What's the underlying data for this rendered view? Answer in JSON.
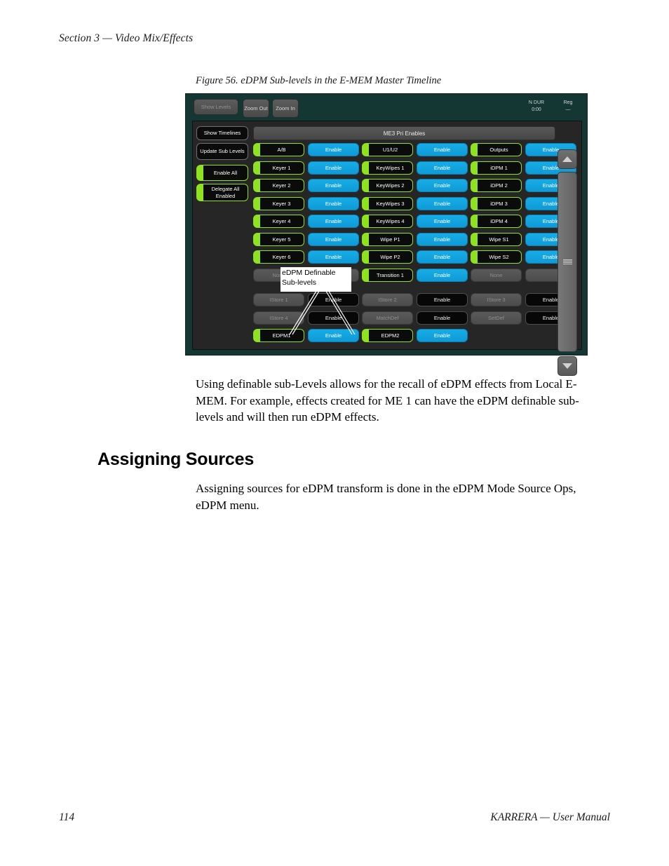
{
  "document": {
    "header": "Section 3 — Video Mix/Effects",
    "page_number": "114",
    "footer_right": "KARRERA  —  User Manual",
    "figure_caption": "Figure 56.  eDPM Sub-levels in the E-MEM Master Timeline",
    "paragraph_1": "Using definable sub-Levels allows for the recall of eDPM effects from Local E-MEM. For example, effects created for ME 1 can have the eDPM definable sub-levels and will then run eDPM effects.",
    "section_heading": "Assigning Sources",
    "paragraph_2": "Assigning sources for eDPM transform is done in the eDPM Mode Source Ops, eDPM menu."
  },
  "callout": {
    "text": "eDPM Definable Sub-levels"
  },
  "panel": {
    "toolbar": {
      "show_levels": "Show Levels",
      "zoom_out": "Zoom Out",
      "zoom_in": "Zoom In"
    },
    "status": {
      "dur_label": "N DUR",
      "dur_value": "0:00",
      "reg_label": "Reg",
      "reg_value": "—"
    },
    "sidebar": {
      "show_timelines": "Show Timelines",
      "update_sub_levels": "Update Sub Levels",
      "enable_all": "Enable All",
      "delegate_all_enabled": "Delegate All Enabled"
    },
    "level_header": "ME3 Pri Enables",
    "scrollbar": {
      "up": "scroll-up",
      "down": "scroll-down"
    },
    "rows": [
      [
        {
          "name": "A/B",
          "state": "active",
          "enable": "Enable",
          "enable_state": "on"
        },
        {
          "name": "U1/U2",
          "state": "active",
          "enable": "Enable",
          "enable_state": "on"
        },
        {
          "name": "Outputs",
          "state": "active",
          "enable": "Enable",
          "enable_state": "on"
        }
      ],
      [
        {
          "name": "Keyer 1",
          "state": "active",
          "enable": "Enable",
          "enable_state": "on"
        },
        {
          "name": "KeyWipes 1",
          "state": "active",
          "enable": "Enable",
          "enable_state": "on"
        },
        {
          "name": "iDPM 1",
          "state": "active",
          "enable": "Enable",
          "enable_state": "on"
        }
      ],
      [
        {
          "name": "Keyer 2",
          "state": "active",
          "enable": "Enable",
          "enable_state": "on"
        },
        {
          "name": "KeyWipes 2",
          "state": "active",
          "enable": "Enable",
          "enable_state": "on"
        },
        {
          "name": "iDPM 2",
          "state": "active",
          "enable": "Enable",
          "enable_state": "on"
        }
      ],
      [
        {
          "name": "Keyer 3",
          "state": "active",
          "enable": "Enable",
          "enable_state": "on"
        },
        {
          "name": "KeyWipes 3",
          "state": "active",
          "enable": "Enable",
          "enable_state": "on"
        },
        {
          "name": "iDPM 3",
          "state": "active",
          "enable": "Enable",
          "enable_state": "on"
        }
      ],
      [
        {
          "name": "Keyer 4",
          "state": "active",
          "enable": "Enable",
          "enable_state": "on"
        },
        {
          "name": "KeyWipes 4",
          "state": "active",
          "enable": "Enable",
          "enable_state": "on"
        },
        {
          "name": "iDPM 4",
          "state": "active",
          "enable": "Enable",
          "enable_state": "on"
        }
      ],
      [
        {
          "name": "Keyer 5",
          "state": "active",
          "enable": "Enable",
          "enable_state": "on"
        },
        {
          "name": "Wipe P1",
          "state": "active",
          "enable": "Enable",
          "enable_state": "on"
        },
        {
          "name": "Wipe S1",
          "state": "active",
          "enable": "Enable",
          "enable_state": "on"
        }
      ],
      [
        {
          "name": "Keyer 6",
          "state": "active",
          "enable": "Enable",
          "enable_state": "on"
        },
        {
          "name": "Wipe P2",
          "state": "active",
          "enable": "Enable",
          "enable_state": "on"
        },
        {
          "name": "Wipe S2",
          "state": "active",
          "enable": "Enable",
          "enable_state": "on"
        }
      ],
      [
        {
          "name": "None",
          "state": "disabled",
          "enable": "",
          "enable_state": "blank"
        },
        {
          "name": "Transition 1",
          "state": "active",
          "enable": "Enable",
          "enable_state": "on"
        },
        {
          "name": "None",
          "state": "disabled",
          "enable": "",
          "enable_state": "blank"
        }
      ],
      [
        {
          "name": "IStore 1",
          "state": "disabled",
          "enable": "Enable",
          "enable_state": "off"
        },
        {
          "name": "IStore 2",
          "state": "disabled",
          "enable": "Enable",
          "enable_state": "off"
        },
        {
          "name": "IStore 3",
          "state": "disabled",
          "enable": "Enable",
          "enable_state": "off"
        }
      ],
      [
        {
          "name": "IStore 4",
          "state": "disabled",
          "enable": "Enable",
          "enable_state": "off"
        },
        {
          "name": "MatchDef",
          "state": "disabled",
          "enable": "Enable",
          "enable_state": "off"
        },
        {
          "name": "SetDef",
          "state": "disabled",
          "enable": "Enable",
          "enable_state": "off"
        }
      ],
      [
        {
          "name": "EDPM1",
          "state": "active",
          "enable": "Enable",
          "enable_state": "on"
        },
        {
          "name": "EDPM2",
          "state": "active",
          "enable": "Enable",
          "enable_state": "on"
        },
        {
          "name": "",
          "state": "empty",
          "enable": "",
          "enable_state": "empty"
        }
      ]
    ]
  },
  "colors": {
    "panel_bg": "#153733",
    "work_bg": "#262626",
    "accent_green": "#8fe220",
    "accent_blue": "#17ade8",
    "disabled_grey": "#5a5a5a"
  }
}
